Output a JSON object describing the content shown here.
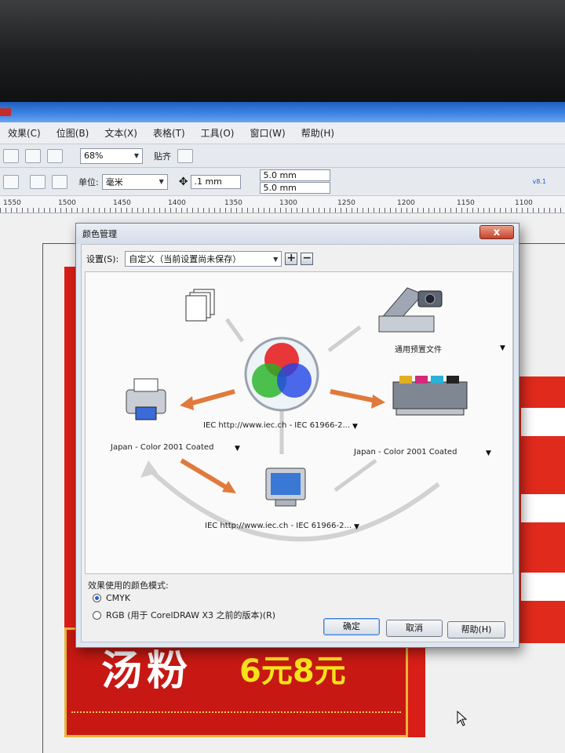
{
  "menu": {
    "items": [
      "效果(C)",
      "位图(B)",
      "文本(X)",
      "表格(T)",
      "工具(O)",
      "窗口(W)",
      "帮助(H)"
    ]
  },
  "toolbar": {
    "zoom": "68%",
    "snap_label": "贴齐",
    "unit_label": "单位:",
    "unit_value": "毫米",
    "nudge": ".1 mm",
    "dup_x": "5.0 mm",
    "dup_y": "5.0 mm",
    "version_badge": "v8.1"
  },
  "ruler": {
    "ticks": [
      "1550",
      "1500",
      "1450",
      "1400",
      "1350",
      "1300",
      "1250",
      "1200",
      "1150",
      "1100"
    ]
  },
  "sign": {
    "text_zh": "汤粉",
    "price": "6元8元"
  },
  "dialog": {
    "title": "颜色管理",
    "close_glyph": "x",
    "settings_label": "设置(S):",
    "settings_value": "自定义（当前设置尚未保存）",
    "add_glyph": "+",
    "remove_glyph": "−",
    "scanner_label": "通用预置文件",
    "printer_label": "Japan - Color 2001 Coated",
    "press_label": "Japan - Color 2001 Coated",
    "center_label": "IEC http://www.iec.ch - IEC 61966-2...",
    "monitor_label": "IEC http://www.iec.ch - IEC 61966-2...",
    "mode_label": "效果使用的颜色模式:",
    "mode_cmyk": "CMYK",
    "mode_rgb": "RGB (用于 CorelDRAW X3 之前的版本)(R)",
    "ok": "确定",
    "cancel": "取消",
    "help": "帮助(H)",
    "dropdown_glyph": "▼"
  },
  "colors": {
    "accent_blue": "#3f86e6",
    "sign_red": "#d81e16",
    "arrow_orange": "#e07a3c",
    "arrow_gray": "#c4c4c4"
  }
}
